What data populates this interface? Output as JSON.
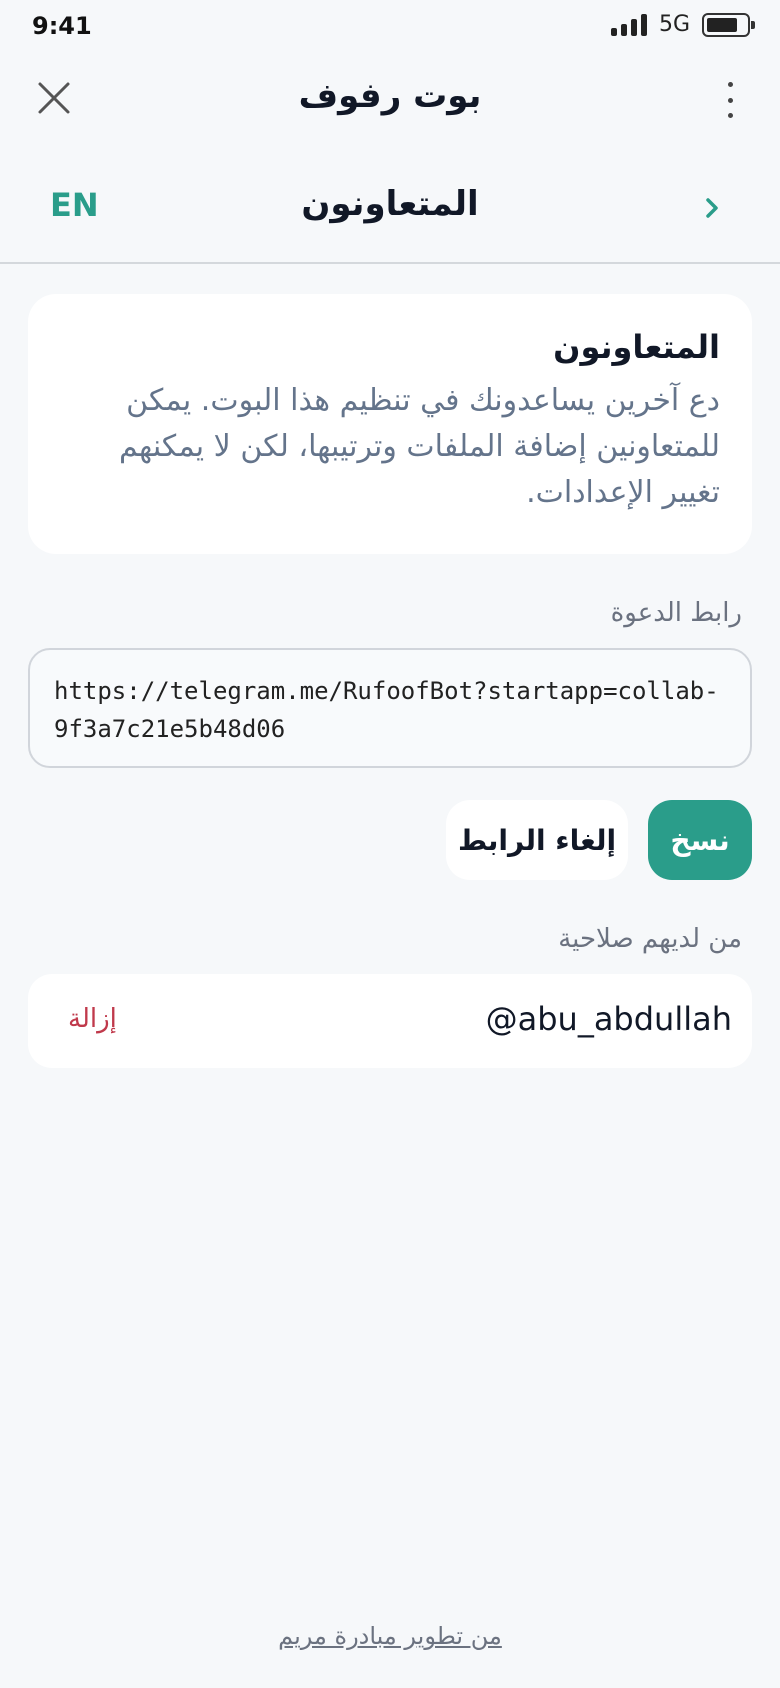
{
  "status_bar": {
    "time": "9:41",
    "network": "5G"
  },
  "header": {
    "title": "بوت رفوف"
  },
  "sub_header": {
    "title": "المتعاونون",
    "lang": "EN"
  },
  "info_card": {
    "title": "المتعاونون",
    "description": "دع آخرين يساعدونك في تنظيم هذا البوت. يمكن للمتعاونين إضافة الملفات وترتيبها، لكن لا يمكنهم تغيير الإعدادات."
  },
  "invite": {
    "label": "رابط الدعوة",
    "url": "https://telegram.me/RufoofBot?startapp=collab-9f3a7c21e5b48d06",
    "copy_label": "نسخ",
    "revoke_label": "إلغاء الرابط"
  },
  "members": {
    "label": "من لديهم صلاحية",
    "items": [
      {
        "username": "@abu_abdullah",
        "remove_label": "إزالة"
      }
    ]
  },
  "footer": {
    "credit": "من تطوير مبادرة مريم"
  },
  "colors": {
    "accent": "#2a9d8a",
    "danger": "#c0394b",
    "background": "#f6f8fa"
  },
  "icons": {
    "close": "close-icon",
    "more": "more-vertical-icon",
    "back": "chevron-right-icon"
  }
}
